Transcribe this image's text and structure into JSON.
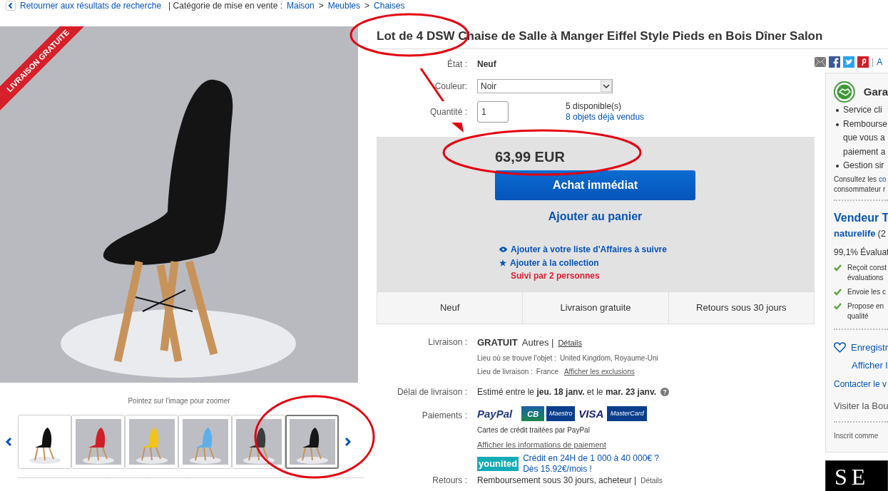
{
  "breadcrumb": [
    {
      "text": "Retourner aux résultats de recherche",
      "kind": "back"
    },
    {
      "text": "| Catégorie de mise en vente :",
      "kind": "plain"
    },
    {
      "text": "Maison",
      "kind": "link"
    },
    {
      "text": ">",
      "kind": "plain"
    },
    {
      "text": "Meubles",
      "kind": "link"
    },
    {
      "text": ">",
      "kind": "plain"
    },
    {
      "text": "Chaises",
      "kind": "link"
    }
  ],
  "gallery": {
    "ribbon": "LIVRAISON GRATUITE",
    "hint": "Pointez sur l'image pour zoomer",
    "thumbnails": [
      {
        "kind": "diagram",
        "color": "#111111",
        "selected": false
      },
      {
        "kind": "photo",
        "color": "#d21f27",
        "selected": false
      },
      {
        "kind": "photo",
        "color": "#f0c419",
        "selected": false
      },
      {
        "kind": "photo",
        "color": "#5cb0ea",
        "selected": false
      },
      {
        "kind": "photo",
        "color": "#3c3c3c",
        "selected": false
      },
      {
        "kind": "photo",
        "color": "#161616",
        "selected": true
      }
    ]
  },
  "title": "Lot de 4 DSW Chaise de Salle à Manger Eiffel Style Pieds en Bois Dîner Salon",
  "details": [
    {
      "label": "État :",
      "kind": "text",
      "value": "Neuf"
    },
    {
      "label": "Couleur:",
      "kind": "select",
      "value": "Noir"
    },
    {
      "label": "Quantité :",
      "kind": "input",
      "value": "1",
      "available": "5 disponible(s)",
      "sold_link": "8 objets déjà vendus"
    }
  ],
  "buy_box": {
    "price": "63,99 EUR",
    "buy_button": "Achat immédiat",
    "cart_link": "Ajouter au panier",
    "watch_links": [
      {
        "kind": "eye",
        "text": "Ajouter à votre liste d'Affaires à suivre"
      },
      {
        "kind": "star",
        "text": "Ajouter à la collection"
      }
    ],
    "watchers": "Suivi par 2 personnes"
  },
  "highlights": [
    "Neuf",
    "Livraison gratuite",
    "Retours sous 30 jours"
  ],
  "shipping": {
    "label": "Livraison :",
    "cost": "GRATUIT",
    "service": "Autres |",
    "details_link": "Détails",
    "location_label": "Lieu où se trouve l'objet :",
    "location": "United Kingdom, Royaume-Uni",
    "destination_label": "Lieu de livraison :",
    "destination": "France",
    "exclusions_link": "Afficher les exclusions"
  },
  "delivery": {
    "label": "Délai de livraison :",
    "text": "Estimé entre le **jeu. 18 janv.** et le **mar. 23 janv.**"
  },
  "payments": {
    "label": "Paiements :",
    "logos": [
      {
        "kind": "paypal",
        "text": "PayPal"
      },
      {
        "kind": "cb",
        "text": "CB"
      },
      {
        "kind": "maestro",
        "text": "Maestro"
      },
      {
        "kind": "visa",
        "text": "VISA"
      },
      {
        "kind": "mastercard",
        "text": "MasterCard"
      }
    ],
    "note": "Cartes de crédit traitées par PayPal",
    "info_link": "Afficher les informations de paiement",
    "credit_logo": "younited",
    "credit_lines": [
      "Crédit en 24H de 1 000 à 40 000€ ?",
      "Dès 15.92€/mois !"
    ]
  },
  "returns": {
    "label": "Retours :",
    "text": "Remboursement sous 30 jours, acheteur |",
    "details_link": "Détails"
  },
  "share": {
    "separator": "|",
    "link": "A"
  },
  "guarantee": {
    "title": "Gara",
    "bullets": [
      [
        "Service cli"
      ],
      [
        "Rembourse",
        "que vous a",
        "paiement a"
      ],
      [
        "Gestion sir"
      ]
    ],
    "note_start": "Consultez les",
    "note_link": "co",
    "note_end": "consommateur r"
  },
  "seller": {
    "heading": "Vendeur T",
    "name": "naturelife",
    "count": "(2",
    "rating": "99,1% Évaluat",
    "checks": [
      [
        "Reçoit const",
        "évaluations"
      ],
      [
        "Envoie les c"
      ],
      [
        "Propose en",
        "qualité"
      ]
    ],
    "save_link": "Enregistr",
    "show_link": "Afficher l",
    "contact_link": "Contacter le v",
    "store_link": "Visiter la Bou",
    "member": "Inscrit comme"
  },
  "banner": "SE"
}
